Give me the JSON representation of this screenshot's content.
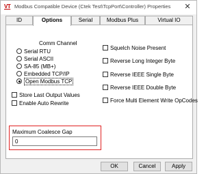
{
  "window": {
    "title": "Modbus Compatible Device (Ctek Test\\TcpPort\\Controller) Properties",
    "close_glyph": "✕",
    "icon_text": "VT"
  },
  "tabs": [
    {
      "label": "ID"
    },
    {
      "label": "Options"
    },
    {
      "label": "Serial"
    },
    {
      "label": "Modbus Plus"
    },
    {
      "label": "Virtual IO"
    }
  ],
  "comm_channel": {
    "title": "Comm Channel",
    "options": [
      "Serial RTU",
      "Serial ASCII",
      "SA-85 (MB+)",
      "Embedded TCP/IP",
      "Open Modbus TCP"
    ],
    "selected": "Open Modbus TCP"
  },
  "left_checks": [
    {
      "label": "Store Last Output Values",
      "checked": false
    },
    {
      "label": "Enable Auto Rewrite",
      "checked": false
    }
  ],
  "right_checks": [
    {
      "label": "Squelch Noise Present",
      "checked": false
    },
    {
      "label": "Reverse Long Integer Byte",
      "checked": false
    },
    {
      "label": "Reverse IEEE Single Byte",
      "checked": false
    },
    {
      "label": "Reverse IEEE Double Byte",
      "checked": false
    },
    {
      "label": "Force Multi Element Write OpCodes",
      "checked": false
    }
  ],
  "coalesce": {
    "label": "Maximum Coalesce Gap",
    "value": "0"
  },
  "buttons": {
    "ok": "OK",
    "cancel": "Cancel",
    "apply": "Apply"
  }
}
